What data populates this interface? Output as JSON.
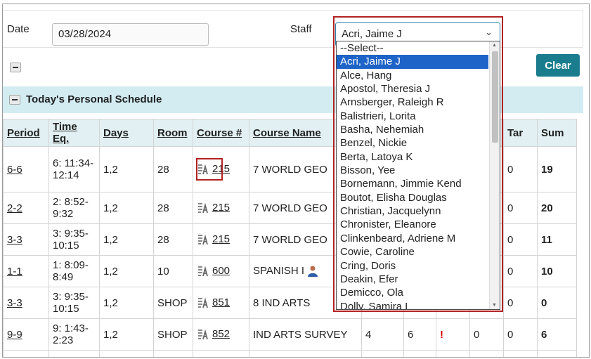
{
  "filters": {
    "date_label": "Date",
    "date_value": "03/28/2024",
    "staff_label": "Staff",
    "staff_value": "Acri, Jaime J"
  },
  "clear_label": "Clear",
  "section_title": "Today's Personal Schedule",
  "columns": {
    "period": "Period",
    "time_eq": "Time Eq.",
    "days": "Days",
    "room": "Room",
    "course_num": "Course #",
    "course_name": "Course Name",
    "tar": "Tar",
    "sum": "Sum"
  },
  "rows": [
    {
      "period": "6-6",
      "time": "6: 11:34- 12:14",
      "days": "1,2",
      "room": "28",
      "course": "215",
      "name": "7 WORLD GEO",
      "tar": "0",
      "sum": "19"
    },
    {
      "period": "2-2",
      "time": "2: 8:52- 9:32",
      "days": "1,2",
      "room": "28",
      "course": "215",
      "name": "7 WORLD GEO",
      "tar": "0",
      "sum": "20"
    },
    {
      "period": "3-3",
      "time": "3: 9:35- 10:15",
      "days": "1,2",
      "room": "28",
      "course": "215",
      "name": "7 WORLD GEO",
      "tar": "0",
      "sum": "11"
    },
    {
      "period": "1-1",
      "time": "1: 8:09- 8:49",
      "days": "1,2",
      "room": "10",
      "course": "600",
      "name": "SPANISH I",
      "tar": "0",
      "sum": "10"
    },
    {
      "period": "3-3",
      "time": "3: 9:35- 10:15",
      "days": "1,2",
      "room": "SHOP",
      "course": "851",
      "name": "8 IND ARTS",
      "tar": "0",
      "sum": "0"
    },
    {
      "period": "9-9",
      "time": "9: 1:43- 2:23",
      "days": "1,2",
      "room": "SHOP",
      "course": "852",
      "name": "IND ARTS SURVEY",
      "c1": "4",
      "c2": "6",
      "flag": "!",
      "c3": "0",
      "tar": "0",
      "sum": "6"
    }
  ],
  "staff_options": [
    "--Select--",
    "Acri, Jaime J",
    "Alce, Hang",
    "Apostol, Theresia J",
    "Arnsberger, Raleigh R",
    "Balistrieri, Lorita",
    "Basha, Nehemiah",
    "Benzel, Nickie",
    "Berta, Latoya K",
    "Bisson, Yee",
    "Bornemann, Jimmie Kend",
    "Boutot, Elisha Douglas",
    "Christian, Jacquelynn",
    "Chronister, Eleanore",
    "Clinkenbeard, Adriene M",
    "Cowie, Caroline",
    "Cring, Doris",
    "Deakin, Efer",
    "Demicco, Ola",
    "Dolly, Samira L"
  ],
  "icons": {
    "collapse": "minus-box-icon",
    "course_detail": "course-detail-icon",
    "teacher": "person-icon",
    "chevron": "chevron-down-icon"
  },
  "colors": {
    "accent": "#1a7d8e",
    "section_bg": "#d2ecf2",
    "selected_option": "#1e63c7",
    "highlight": "#b22222",
    "alert": "#d60000"
  }
}
